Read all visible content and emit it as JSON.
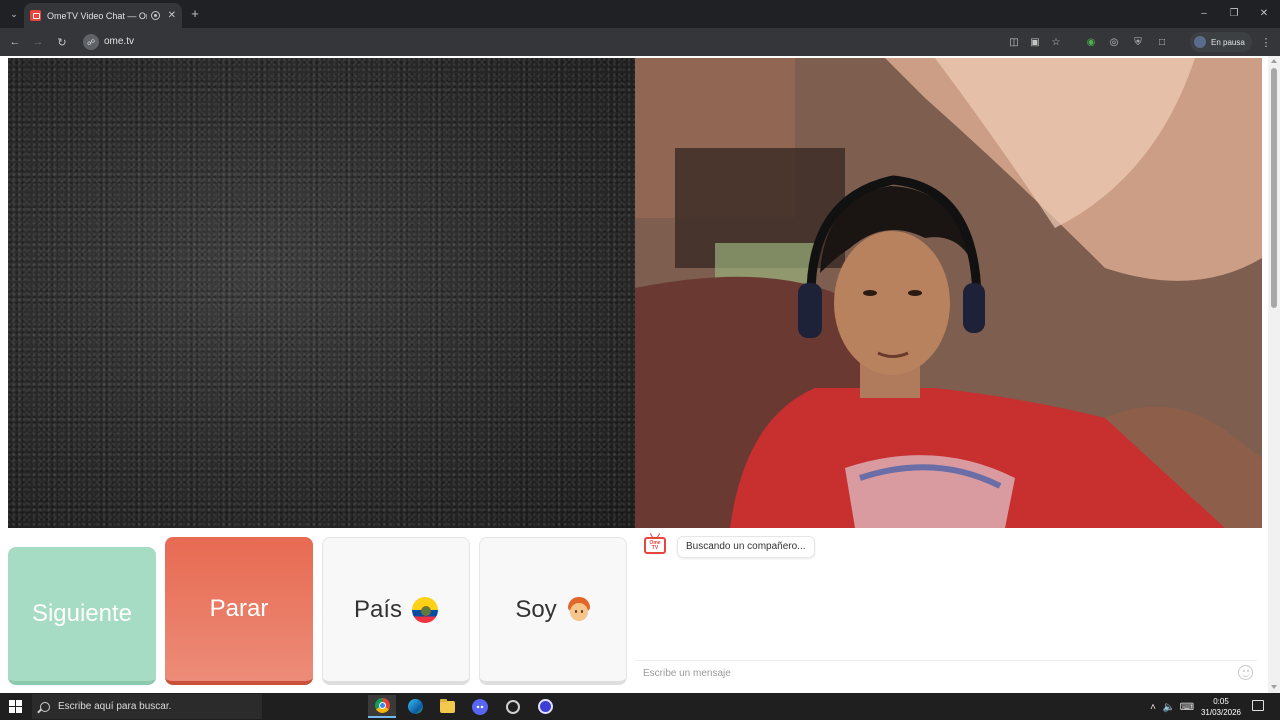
{
  "browser": {
    "tab_title": "OmeTV Video Chat — Om…",
    "tab_close": "✕",
    "new_tab": "+",
    "tab_list": "⌄",
    "url": "ome.tv",
    "profile_label": "En pausa",
    "window": {
      "minimize": "–",
      "restore": "❐",
      "close": "✕"
    },
    "nav": {
      "back": "←",
      "forward": "→",
      "reload": "↻"
    },
    "toolbar_icons": [
      "translate-icon",
      "cast-icon",
      "bookmark-star-icon",
      "extension-green-icon",
      "extension-shield-icon",
      "extension-vpn-icon",
      "extensions-puzzle-icon"
    ],
    "menu": "⋮"
  },
  "video": {
    "local_feed": "static-noise",
    "remote_feed": "partner-camera"
  },
  "controls": {
    "next_label": "Siguiente",
    "stop_label": "Parar",
    "country_label": "País",
    "country_flag": "ecuador-flag-icon",
    "gender_label": "Soy",
    "gender_icon": "boy-face-icon",
    "colors": {
      "next": "#a6dcc4",
      "stop": "#e86a52",
      "neutral": "#f8f8f8"
    }
  },
  "chat": {
    "logo_text": "Ome TV",
    "status_message": "Buscando un compañero...",
    "input_placeholder": "Escribe un mensaje"
  },
  "taskbar": {
    "search_placeholder": "Escribe aquí para buscar.",
    "apps": [
      "chrome-icon",
      "edge-icon",
      "file-explorer-icon",
      "discord-icon",
      "settings-gear-icon",
      "obs-icon"
    ],
    "tray": {
      "chevron": "˄",
      "volume": "🔈",
      "keyboard": "⌨"
    },
    "time": "0:05",
    "date": "31/03/2026"
  }
}
